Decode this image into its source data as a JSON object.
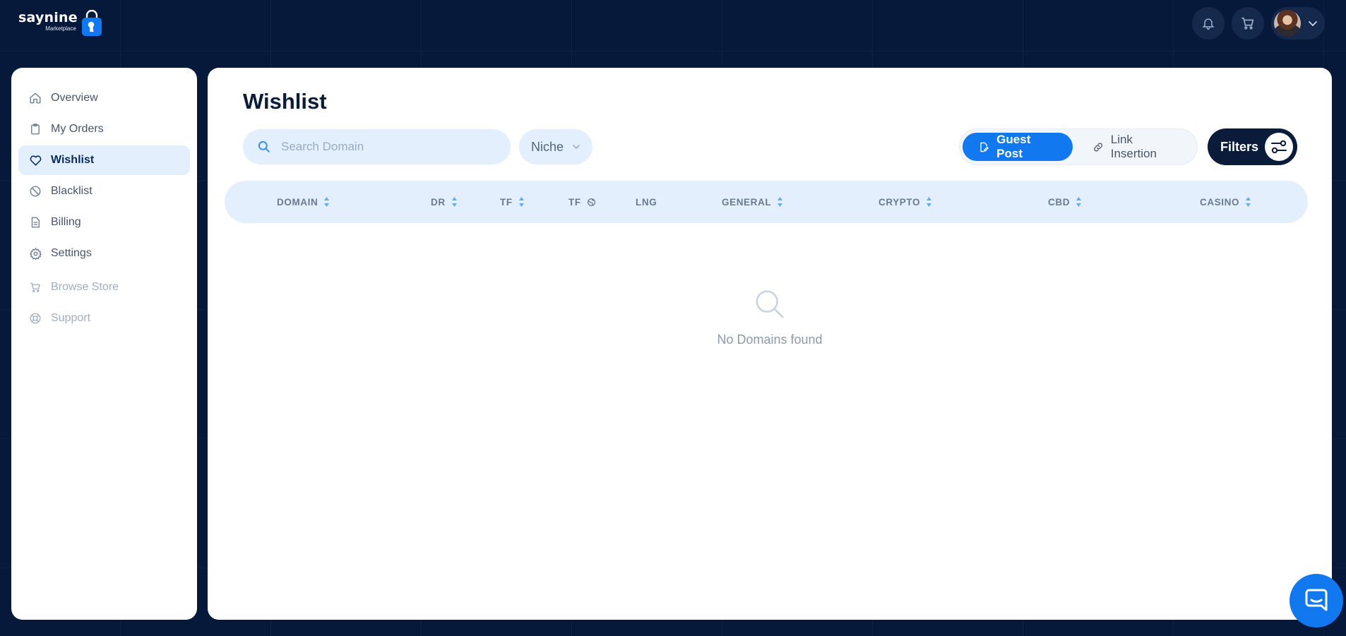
{
  "brand": {
    "name": "saynine",
    "sub": "Marketplace"
  },
  "topbar": {
    "notifications_icon": "bell-icon",
    "cart_icon": "cart-icon",
    "user_menu_icon": "chevron-down-icon"
  },
  "sidebar": {
    "items": [
      {
        "label": "Overview",
        "icon": "home-icon"
      },
      {
        "label": "My Orders",
        "icon": "clipboard-icon"
      },
      {
        "label": "Wishlist",
        "icon": "heart-icon",
        "active": true
      },
      {
        "label": "Blacklist",
        "icon": "ban-icon"
      },
      {
        "label": "Billing",
        "icon": "document-icon"
      },
      {
        "label": "Settings",
        "icon": "gear-icon"
      }
    ],
    "secondary": [
      {
        "label": "Browse Store",
        "icon": "cart-icon"
      },
      {
        "label": "Support",
        "icon": "lifebuoy-icon"
      }
    ]
  },
  "main": {
    "title": "Wishlist",
    "search": {
      "placeholder": "Search Domain",
      "value": ""
    },
    "niche": {
      "label": "Niche"
    },
    "toggle": {
      "options": [
        "Guest Post",
        "Link Insertion"
      ],
      "selected": "Guest Post"
    },
    "filters_label": "Filters",
    "columns": [
      "DOMAIN",
      "DR",
      "TF",
      "TF",
      "LNG",
      "GENERAL",
      "CRYPTO",
      "CBD",
      "CASINO"
    ],
    "empty_text": "No Domains found"
  },
  "colors": {
    "accent": "#1278f0",
    "navy": "#0b1b3a",
    "background": "#06193a",
    "light_blue": "#e3effd"
  }
}
